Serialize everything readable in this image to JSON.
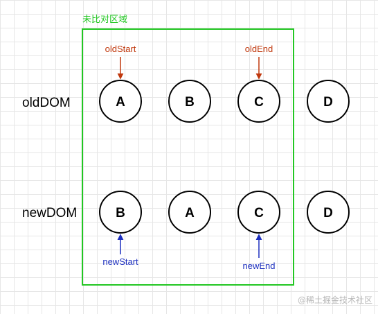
{
  "colors": {
    "region": "#22c722",
    "old_pointer": "#c0380d",
    "new_pointer": "#1c2fbf",
    "node_stroke": "#000000",
    "grid": "#e6e6e6"
  },
  "region": {
    "label": "未比对区域"
  },
  "rows": {
    "old": {
      "label": "oldDOM",
      "nodes": [
        "A",
        "B",
        "C",
        "D"
      ]
    },
    "new": {
      "label": "newDOM",
      "nodes": [
        "B",
        "A",
        "C",
        "D"
      ]
    }
  },
  "pointers": {
    "old_start": "oldStart",
    "old_end": "oldEnd",
    "new_start": "newStart",
    "new_end": "newEnd"
  },
  "watermark": "@稀土掘金技术社区"
}
